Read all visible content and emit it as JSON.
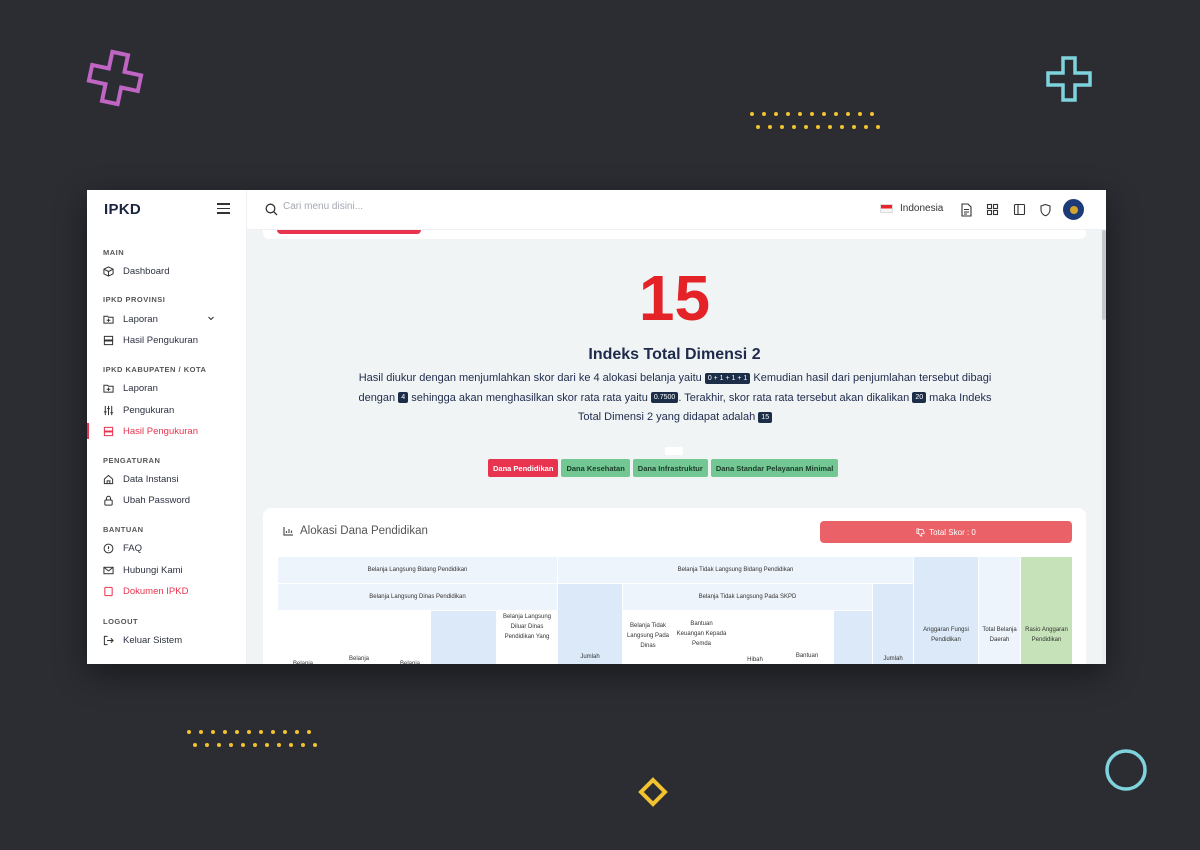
{
  "app": {
    "brand": "IPKD"
  },
  "search": {
    "placeholder": "Cari menu disini..."
  },
  "topbar": {
    "language": "Indonesia"
  },
  "sidebar": {
    "sections": [
      {
        "title": "MAIN",
        "items": [
          {
            "label": "Dashboard",
            "icon": "cube-icon"
          }
        ]
      },
      {
        "title": "IPKD PROVINSI",
        "items": [
          {
            "label": "Laporan",
            "icon": "folder-icon"
          },
          {
            "label": "Hasil Pengukuran",
            "icon": "server-icon"
          }
        ]
      },
      {
        "title": "IPKD KABUPATEN / KOTA",
        "items": [
          {
            "label": "Laporan",
            "icon": "folder-icon"
          },
          {
            "label": "Pengukuran",
            "icon": "sliders-icon"
          },
          {
            "label": "Hasil Pengukuran",
            "icon": "server-icon",
            "active": true
          }
        ]
      },
      {
        "title": "PENGATURAN",
        "items": [
          {
            "label": "Data Instansi",
            "icon": "home-icon"
          },
          {
            "label": "Ubah Password",
            "icon": "lock-icon"
          }
        ]
      },
      {
        "title": "BANTUAN",
        "items": [
          {
            "label": "FAQ",
            "icon": "info-icon"
          },
          {
            "label": "Hubungi Kami",
            "icon": "mail-icon"
          },
          {
            "label": "Dokumen IPKD",
            "icon": "book-icon"
          }
        ]
      },
      {
        "title": "LOGOUT",
        "items": [
          {
            "label": "Keluar Sistem",
            "icon": "logout-icon"
          }
        ]
      }
    ]
  },
  "result": {
    "score": "15",
    "title": "Indeks Total Dimensi 2",
    "p1": "Hasil diukur dengan menjumlahkan skor dari ke 4 alokasi belanja yaitu",
    "chip1": "0 + 1 + 1 + 1",
    "p2": "Kemudian hasil dari penjumlahan tersebut dibagi dengan",
    "chip2": "4",
    "p3": "sehingga akan menghasilkan skor rata rata yaitu",
    "chip3": "0.7500",
    "p4": ". Terakhir, skor rata rata tersebut akan dikalikan",
    "chip4": "20",
    "p5": "maka Indeks Total Dimensi 2 yang didapat adalah",
    "chip5": "15"
  },
  "tabs": [
    {
      "label": "Dana Pendidikan",
      "active": true
    },
    {
      "label": "Dana Kesehatan",
      "active": false
    },
    {
      "label": "Dana Infrastruktur",
      "active": false
    },
    {
      "label": "Dana Standar Pelayanan Minimal",
      "active": false
    }
  ],
  "card": {
    "title": "Alokasi Dana Pendidikan",
    "total_button": "Total Skor : 0"
  },
  "table": {
    "h_langsung": "Belanja Langsung Bidang Pendidikan",
    "h_tidak_langsung": "Belanja Tidak Langsung Bidang Pendidikan",
    "h_langsung_dinas": "Belanja Langsung Dinas Pendidikan",
    "h_tidak_langsung_skpd": "Belanja Tidak Langsung Pada SKPD",
    "c_diluar": "Belanja Langsung Diluar Dinas Pendidikan Yang",
    "c_jumlah1": "Jumlah",
    "c_btl_dinas": "Belanja Tidak Langsung Pada Dinas",
    "c_bantuan_keu": "Bantuan Keuangan Kepada Pemda",
    "c_hibah": "Hibah",
    "c_bantuan": "Bantuan",
    "c_jumlah2": "Jumlah",
    "c_anggaran_fungsi": "Anggaran Fungsi Pendidikan",
    "c_total_belanja": "Total Belanja Daerah",
    "c_rasio": "Rasio Anggaran Pendidikan",
    "c_belanja": "Belanja",
    "c_belanja_a": "Belanja",
    "c_belanja_b": "Belanja"
  },
  "colors": {
    "accent": "#e8344e",
    "navy": "#1f2b4d",
    "tab_green": "#73c792",
    "score_red": "#e32328"
  }
}
